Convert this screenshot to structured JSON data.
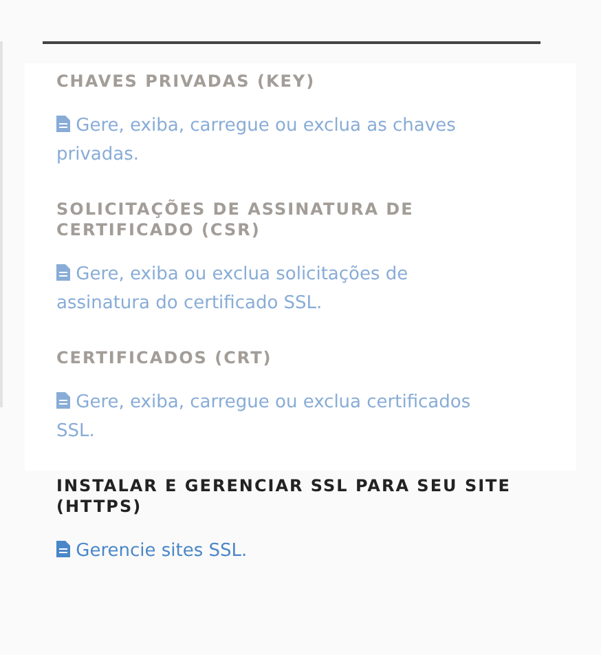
{
  "sections": [
    {
      "heading": "CHAVES PRIVADAS (KEY)",
      "link": "Gere, exiba, carregue ou exclua as chaves privadas.",
      "disabled": true
    },
    {
      "heading": "SOLICITAÇÕES DE ASSINATURA DE CERTIFICADO (CSR)",
      "link": "Gere, exiba ou exclua solicitações de assinatura do certificado SSL.",
      "disabled": true
    },
    {
      "heading": "CERTIFICADOS (CRT)",
      "link": "Gere, exiba, carregue ou exclua certificados SSL.",
      "disabled": true
    },
    {
      "heading": "INSTALAR E GERENCIAR SSL PARA SEU SITE (HTTPS)",
      "link": "Gerencie sites SSL.",
      "disabled": false
    }
  ]
}
